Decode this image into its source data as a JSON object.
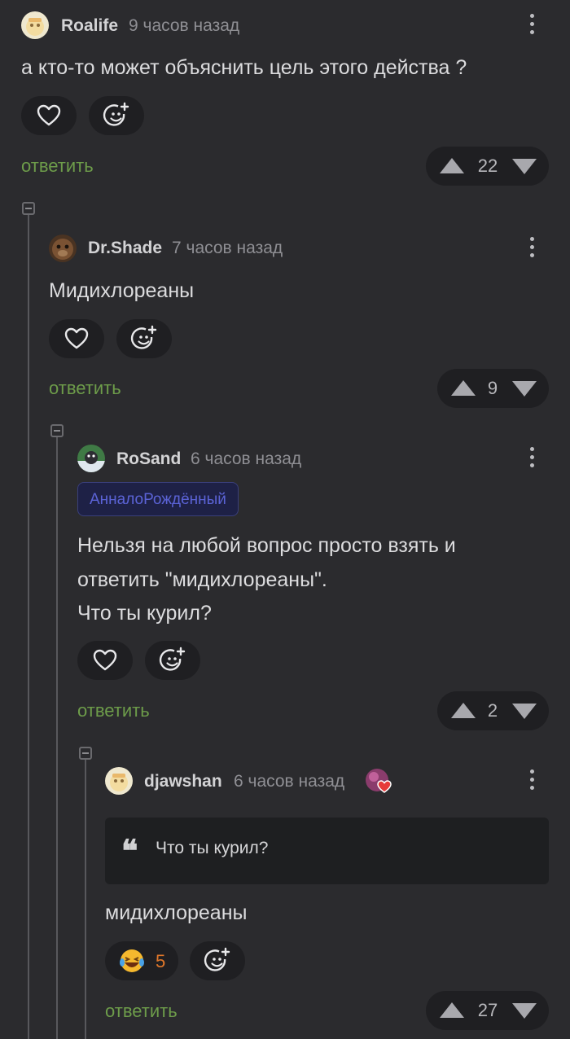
{
  "labels": {
    "reply": "ответить"
  },
  "comments": [
    {
      "user": "Roalife",
      "time": "9 часов назад",
      "text": "а кто-то может объяснить цель этого действа ?",
      "votes": "22"
    },
    {
      "user": "Dr.Shade",
      "time": "7 часов назад",
      "text": "Мидихлореаны",
      "votes": "9"
    },
    {
      "user": "RoSand",
      "time": "6 часов назад",
      "tag": "АнналоРождённый",
      "text_lines": [
        "Нельзя на любой вопрос просто взять и",
        "ответить \"мидихлореаны\".",
        "Что ты курил?"
      ],
      "votes": "2"
    },
    {
      "user": "djawshan",
      "time": "6 часов назад",
      "quote": "Что ты курил?",
      "text": "мидихлореаны",
      "reaction_count": "5",
      "votes": "27"
    }
  ],
  "colors": {
    "background": "#2b2b2e",
    "reply_link": "#6d9c4a",
    "reaction_count": "#e0772a",
    "tag_text": "#5b63d6"
  }
}
